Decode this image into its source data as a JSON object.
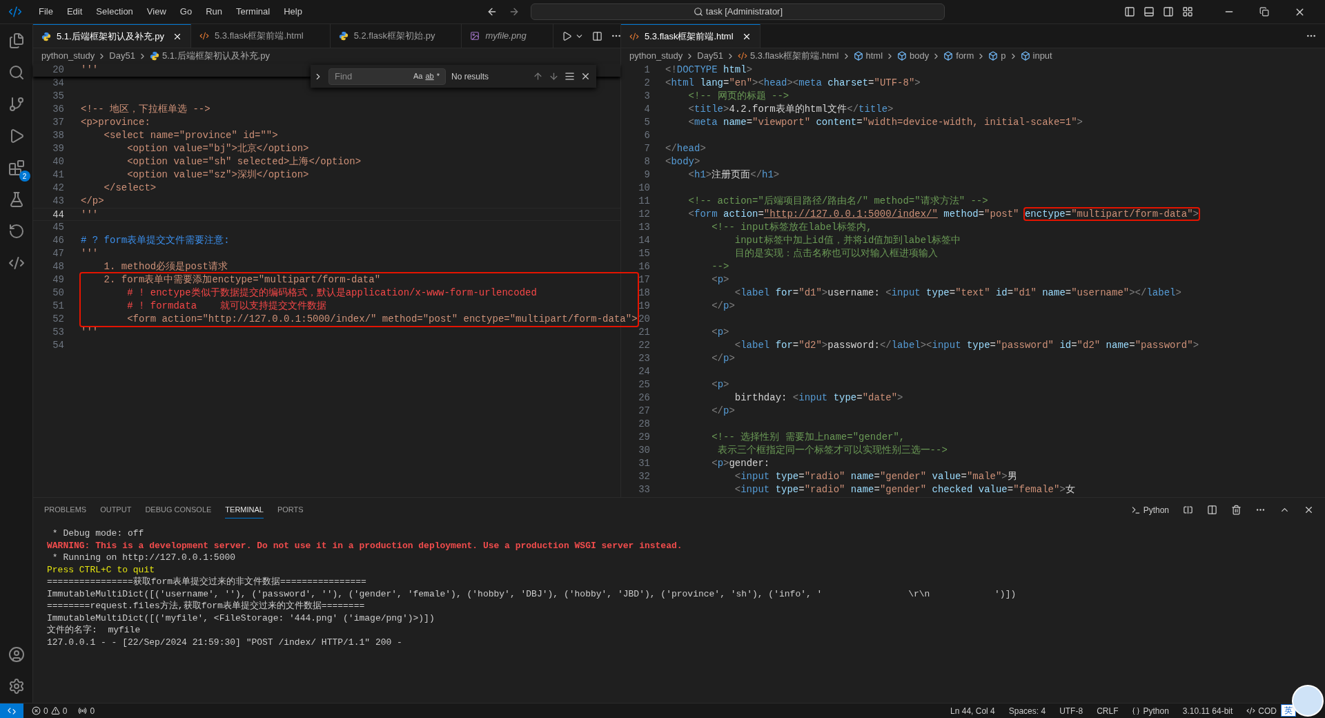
{
  "title_bar": {
    "menus": [
      "File",
      "Edit",
      "Selection",
      "View",
      "Go",
      "Run",
      "Terminal",
      "Help"
    ],
    "command_center": "task [Administrator]"
  },
  "activity_bar": {
    "extensions_badge": "2"
  },
  "left_editor": {
    "tabs": [
      {
        "label": "5.1.后端框架初认及补充.py",
        "kind": "python",
        "selected": true,
        "preview": false
      },
      {
        "label": "5.3.flask框架前端.html",
        "kind": "html",
        "selected": false,
        "preview": false
      },
      {
        "label": "5.2.flask框架初始.py",
        "kind": "python",
        "selected": false,
        "preview": false
      },
      {
        "label": "myfile.png",
        "kind": "image",
        "selected": false,
        "preview": true
      }
    ],
    "breadcrumbs": [
      {
        "text": "python_study",
        "kind": "folder"
      },
      {
        "text": "Day51",
        "kind": "folder"
      },
      {
        "text": "5.1.后端框架初认及补充.py",
        "kind": "python"
      }
    ],
    "sticky_line": {
      "n": "20",
      "text": "'''"
    },
    "find": {
      "placeholder": "Find",
      "toggles": [
        "Aa",
        "ab",
        "*"
      ],
      "result": "No results"
    },
    "lines": [
      {
        "n": "34",
        "current": false
      },
      {
        "n": "35",
        "current": false
      },
      {
        "n": "36",
        "text": "<!-- 地区，下拉框单选 -->",
        "kind": "str",
        "current": false
      },
      {
        "n": "37",
        "text": "<p>province:",
        "kind": "str",
        "current": false
      },
      {
        "n": "38",
        "text": "    <select name=\"province\" id=\"\">",
        "kind": "str",
        "current": false
      },
      {
        "n": "39",
        "text": "        <option value=\"bj\">北京</option>",
        "kind": "str",
        "current": false
      },
      {
        "n": "40",
        "text": "        <option value=\"sh\" selected>上海</option>",
        "kind": "str",
        "current": false
      },
      {
        "n": "41",
        "text": "        <option value=\"sz\">深圳</option>",
        "kind": "str",
        "current": false
      },
      {
        "n": "42",
        "text": "    </select>",
        "kind": "str",
        "current": false
      },
      {
        "n": "43",
        "text": "</p>",
        "kind": "str",
        "current": false
      },
      {
        "n": "44",
        "text": "'''",
        "kind": "str",
        "current": true
      },
      {
        "n": "45",
        "current": false
      },
      {
        "n": "46",
        "text": "# ? form表单提交文件需要注意:",
        "kind": "note",
        "current": false
      },
      {
        "n": "47",
        "text": "'''",
        "kind": "str",
        "current": false
      },
      {
        "n": "48",
        "text": "    1. method必须是post请求",
        "kind": "str",
        "current": false
      },
      {
        "kind": "box",
        "lines": [
          {
            "n": "49",
            "text": "    2. form表单中需要添加enctype=\"multipart/form-data\"",
            "kind": "str",
            "current": false
          },
          {
            "n": "50",
            "text": "        # ! enctype类似于数据提交的编码格式，默认是application/x-www-form-urlencoded",
            "kind": "alert",
            "current": false
          },
          {
            "n": "51",
            "text": "        # ! formdata    就可以支持提交文件数据",
            "kind": "alert",
            "current": false
          },
          {
            "n": "52",
            "text": "        <form action=\"http://127.0.0.1:5000/index/\" method=\"post\" enctype=\"multipart/form-data\">",
            "kind": "str",
            "current": false
          }
        ]
      },
      {
        "n": "53",
        "text": "'''",
        "kind": "str",
        "current": false
      },
      {
        "n": "54",
        "current": false
      }
    ]
  },
  "right_editor": {
    "tabs": [
      {
        "label": "5.3.flask框架前端.html",
        "kind": "html",
        "selected": true,
        "preview": false
      }
    ],
    "breadcrumbs": [
      {
        "text": "python_study",
        "kind": "folder"
      },
      {
        "text": "Day51",
        "kind": "folder"
      },
      {
        "text": "5.3.flask框架前端.html",
        "kind": "html"
      },
      {
        "text": "html",
        "kind": "element"
      },
      {
        "text": "body",
        "kind": "element"
      },
      {
        "text": "form",
        "kind": "element"
      },
      {
        "text": "p",
        "kind": "element"
      },
      {
        "text": "input",
        "kind": "element"
      }
    ],
    "lines": [
      {
        "n": "1",
        "tokens": [
          {
            "text": "<!",
            "kind": "p"
          },
          {
            "text": "DOCTYPE",
            "kind": "tg"
          },
          {
            "text": " html",
            "kind": "a"
          },
          {
            "text": ">",
            "kind": "p"
          }
        ]
      },
      {
        "n": "2",
        "tokens": [
          {
            "text": "<",
            "kind": "p"
          },
          {
            "text": "html",
            "kind": "tg"
          },
          {
            "text": " lang",
            "kind": "a"
          },
          {
            "text": "=",
            "kind": "x"
          },
          {
            "text": "\"en\"",
            "kind": "s"
          },
          {
            "text": "><",
            "kind": "p"
          },
          {
            "text": "head",
            "kind": "tg"
          },
          {
            "text": "><",
            "kind": "p"
          },
          {
            "text": "meta",
            "kind": "tg"
          },
          {
            "text": " charset",
            "kind": "a"
          },
          {
            "text": "=",
            "kind": "x"
          },
          {
            "text": "\"UTF-8\"",
            "kind": "s"
          },
          {
            "text": ">",
            "kind": "p"
          }
        ]
      },
      {
        "n": "3",
        "tokens": [
          {
            "text": "    <!-- 网页的标题 -->",
            "kind": "c"
          }
        ]
      },
      {
        "n": "4",
        "tokens": [
          {
            "text": "    <",
            "kind": "p"
          },
          {
            "text": "title",
            "kind": "tg"
          },
          {
            "text": ">",
            "kind": "p"
          },
          {
            "text": "4.2.form表单的html文件",
            "kind": "x"
          },
          {
            "text": "</",
            "kind": "p"
          },
          {
            "text": "title",
            "kind": "tg"
          },
          {
            "text": ">",
            "kind": "p"
          }
        ]
      },
      {
        "n": "5",
        "tokens": [
          {
            "text": "    <",
            "kind": "p"
          },
          {
            "text": "meta",
            "kind": "tg"
          },
          {
            "text": " name",
            "kind": "a"
          },
          {
            "text": "=",
            "kind": "x"
          },
          {
            "text": "\"viewport\"",
            "kind": "s"
          },
          {
            "text": " content",
            "kind": "a"
          },
          {
            "text": "=",
            "kind": "x"
          },
          {
            "text": "\"width=device-width, initial-scake=1\"",
            "kind": "s"
          },
          {
            "text": ">",
            "kind": "p"
          }
        ]
      },
      {
        "n": "6"
      },
      {
        "n": "7",
        "tokens": [
          {
            "text": "</",
            "kind": "p"
          },
          {
            "text": "head",
            "kind": "tg"
          },
          {
            "text": ">",
            "kind": "p"
          }
        ]
      },
      {
        "n": "8",
        "tokens": [
          {
            "text": "<",
            "kind": "p"
          },
          {
            "text": "body",
            "kind": "tg"
          },
          {
            "text": ">",
            "kind": "p"
          }
        ]
      },
      {
        "n": "9",
        "tokens": [
          {
            "text": "    <",
            "kind": "p"
          },
          {
            "text": "h1",
            "kind": "tg"
          },
          {
            "text": ">",
            "kind": "p"
          },
          {
            "text": "注册页面",
            "kind": "x"
          },
          {
            "text": "</",
            "kind": "p"
          },
          {
            "text": "h1",
            "kind": "tg"
          },
          {
            "text": ">",
            "kind": "p"
          }
        ]
      },
      {
        "n": "10"
      },
      {
        "n": "11",
        "tokens": [
          {
            "text": "    <!-- action=\"后端项目路径/路由名/\" method=\"请求方法\" -->",
            "kind": "c"
          }
        ]
      },
      {
        "n": "12",
        "tokens": [
          {
            "text": "    <",
            "kind": "p"
          },
          {
            "text": "form",
            "kind": "tg"
          },
          {
            "text": " action",
            "kind": "a"
          },
          {
            "text": "=",
            "kind": "x"
          },
          {
            "text": "\"http://127.0.0.1:5000/index/\"",
            "kind": "u"
          },
          {
            "text": " method",
            "kind": "a"
          },
          {
            "text": "=",
            "kind": "x"
          },
          {
            "text": "\"post\" ",
            "kind": "s"
          },
          {
            "kind": "boxed",
            "tokens": [
              {
                "text": "enctype",
                "kind": "a"
              },
              {
                "text": "=",
                "kind": "x"
              },
              {
                "text": "\"multipart/form-data\"",
                "kind": "s"
              },
              {
                "text": ">",
                "kind": "p"
              }
            ]
          }
        ]
      },
      {
        "n": "13",
        "tokens": [
          {
            "text": "        <!-- input标签放在label标签内,",
            "kind": "c"
          }
        ]
      },
      {
        "n": "14",
        "tokens": [
          {
            "text": "            input标签中加上id值，并将id值加到label标签中",
            "kind": "c"
          }
        ]
      },
      {
        "n": "15",
        "tokens": [
          {
            "text": "            目的是实现：点击名称也可以对输入框进项输入",
            "kind": "c"
          }
        ]
      },
      {
        "n": "16",
        "tokens": [
          {
            "text": "        -->",
            "kind": "c"
          }
        ]
      },
      {
        "n": "17",
        "tokens": [
          {
            "text": "        <",
            "kind": "p"
          },
          {
            "text": "p",
            "kind": "tg"
          },
          {
            "text": ">",
            "kind": "p"
          }
        ]
      },
      {
        "n": "18",
        "tokens": [
          {
            "text": "            <",
            "kind": "p"
          },
          {
            "text": "label",
            "kind": "tg"
          },
          {
            "text": " for",
            "kind": "a"
          },
          {
            "text": "=",
            "kind": "x"
          },
          {
            "text": "\"d1\"",
            "kind": "s"
          },
          {
            "text": ">",
            "kind": "p"
          },
          {
            "text": "username: ",
            "kind": "x"
          },
          {
            "text": "<",
            "kind": "p"
          },
          {
            "text": "input",
            "kind": "tg"
          },
          {
            "text": " type",
            "kind": "a"
          },
          {
            "text": "=",
            "kind": "x"
          },
          {
            "text": "\"text\"",
            "kind": "s"
          },
          {
            "text": " id",
            "kind": "a"
          },
          {
            "text": "=",
            "kind": "x"
          },
          {
            "text": "\"d1\"",
            "kind": "s"
          },
          {
            "text": " name",
            "kind": "a"
          },
          {
            "text": "=",
            "kind": "x"
          },
          {
            "text": "\"username\"",
            "kind": "s"
          },
          {
            "text": "></",
            "kind": "p"
          },
          {
            "text": "label",
            "kind": "tg"
          },
          {
            "text": ">",
            "kind": "p"
          }
        ]
      },
      {
        "n": "19",
        "tokens": [
          {
            "text": "        </",
            "kind": "p"
          },
          {
            "text": "p",
            "kind": "tg"
          },
          {
            "text": ">",
            "kind": "p"
          }
        ]
      },
      {
        "n": "20"
      },
      {
        "n": "21",
        "tokens": [
          {
            "text": "        <",
            "kind": "p"
          },
          {
            "text": "p",
            "kind": "tg"
          },
          {
            "text": ">",
            "kind": "p"
          }
        ]
      },
      {
        "n": "22",
        "tokens": [
          {
            "text": "            <",
            "kind": "p"
          },
          {
            "text": "label",
            "kind": "tg"
          },
          {
            "text": " for",
            "kind": "a"
          },
          {
            "text": "=",
            "kind": "x"
          },
          {
            "text": "\"d2\"",
            "kind": "s"
          },
          {
            "text": ">",
            "kind": "p"
          },
          {
            "text": "password:",
            "kind": "x"
          },
          {
            "text": "</",
            "kind": "p"
          },
          {
            "text": "label",
            "kind": "tg"
          },
          {
            "text": "><",
            "kind": "p"
          },
          {
            "text": "input",
            "kind": "tg"
          },
          {
            "text": " type",
            "kind": "a"
          },
          {
            "text": "=",
            "kind": "x"
          },
          {
            "text": "\"password\"",
            "kind": "s"
          },
          {
            "text": " id",
            "kind": "a"
          },
          {
            "text": "=",
            "kind": "x"
          },
          {
            "text": "\"d2\"",
            "kind": "s"
          },
          {
            "text": " name",
            "kind": "a"
          },
          {
            "text": "=",
            "kind": "x"
          },
          {
            "text": "\"password\"",
            "kind": "s"
          },
          {
            "text": ">",
            "kind": "p"
          }
        ]
      },
      {
        "n": "23",
        "tokens": [
          {
            "text": "        </",
            "kind": "p"
          },
          {
            "text": "p",
            "kind": "tg"
          },
          {
            "text": ">",
            "kind": "p"
          }
        ]
      },
      {
        "n": "24"
      },
      {
        "n": "25",
        "tokens": [
          {
            "text": "        <",
            "kind": "p"
          },
          {
            "text": "p",
            "kind": "tg"
          },
          {
            "text": ">",
            "kind": "p"
          }
        ]
      },
      {
        "n": "26",
        "tokens": [
          {
            "text": "            birthday: ",
            "kind": "x"
          },
          {
            "text": "<",
            "kind": "p"
          },
          {
            "text": "input",
            "kind": "tg"
          },
          {
            "text": " type",
            "kind": "a"
          },
          {
            "text": "=",
            "kind": "x"
          },
          {
            "text": "\"date\"",
            "kind": "s"
          },
          {
            "text": ">",
            "kind": "p"
          }
        ]
      },
      {
        "n": "27",
        "tokens": [
          {
            "text": "        </",
            "kind": "p"
          },
          {
            "text": "p",
            "kind": "tg"
          },
          {
            "text": ">",
            "kind": "p"
          }
        ]
      },
      {
        "n": "28"
      },
      {
        "n": "29",
        "tokens": [
          {
            "text": "        <!-- 选择性别 需要加上name=\"gender\",",
            "kind": "c"
          }
        ]
      },
      {
        "n": "30",
        "tokens": [
          {
            "text": "         表示三个框指定同一个标签才可以实现性别三选一-->",
            "kind": "c"
          }
        ]
      },
      {
        "n": "31",
        "tokens": [
          {
            "text": "        <",
            "kind": "p"
          },
          {
            "text": "p",
            "kind": "tg"
          },
          {
            "text": ">",
            "kind": "p"
          },
          {
            "text": "gender:",
            "kind": "x"
          }
        ]
      },
      {
        "n": "32",
        "tokens": [
          {
            "text": "            <",
            "kind": "p"
          },
          {
            "text": "input",
            "kind": "tg"
          },
          {
            "text": " type",
            "kind": "a"
          },
          {
            "text": "=",
            "kind": "x"
          },
          {
            "text": "\"radio\"",
            "kind": "s"
          },
          {
            "text": " name",
            "kind": "a"
          },
          {
            "text": "=",
            "kind": "x"
          },
          {
            "text": "\"gender\"",
            "kind": "s"
          },
          {
            "text": " value",
            "kind": "a"
          },
          {
            "text": "=",
            "kind": "x"
          },
          {
            "text": "\"male\"",
            "kind": "s"
          },
          {
            "text": ">",
            "kind": "p"
          },
          {
            "text": "男",
            "kind": "x"
          }
        ]
      },
      {
        "n": "33",
        "tokens": [
          {
            "text": "            <",
            "kind": "p"
          },
          {
            "text": "input",
            "kind": "tg"
          },
          {
            "text": " type",
            "kind": "a"
          },
          {
            "text": "=",
            "kind": "x"
          },
          {
            "text": "\"radio\"",
            "kind": "s"
          },
          {
            "text": " name",
            "kind": "a"
          },
          {
            "text": "=",
            "kind": "x"
          },
          {
            "text": "\"gender\"",
            "kind": "s"
          },
          {
            "text": " checked",
            "kind": "a"
          },
          {
            "text": " value",
            "kind": "a"
          },
          {
            "text": "=",
            "kind": "x"
          },
          {
            "text": "\"female\"",
            "kind": "s"
          },
          {
            "text": ">",
            "kind": "p"
          },
          {
            "text": "女",
            "kind": "x"
          }
        ]
      }
    ]
  },
  "panel": {
    "tabs": [
      {
        "label": "PROBLEMS",
        "selected": false
      },
      {
        "label": "OUTPUT",
        "selected": false
      },
      {
        "label": "DEBUG CONSOLE",
        "selected": false
      },
      {
        "label": "TERMINAL",
        "selected": true
      },
      {
        "label": "PORTS",
        "selected": false
      }
    ],
    "terminal_name": "Python",
    "terminal_lines": [
      {
        "text": " * Debug mode: off",
        "kind": "normal"
      },
      {
        "text": "WARNING: This is a development server. Do not use it in a production deployment. Use a production WSGI server instead.",
        "kind": "warning"
      },
      {
        "text": " * Running on http://127.0.0.1:5000",
        "kind": "normal"
      },
      {
        "text": "Press CTRL+C to quit",
        "kind": "yellow"
      },
      {
        "text": "================获取form表单提交过来的非文件数据================",
        "kind": "normal"
      },
      {
        "text": "ImmutableMultiDict([('username', ''), ('password', ''), ('gender', 'female'), ('hobby', 'DBJ'), ('hobby', 'JBD'), ('province', 'sh'), ('info', '                \\r\\n            ')])",
        "kind": "normal"
      },
      {
        "text": "========request.files方法,获取form表单提交过来的文件数据========",
        "kind": "normal"
      },
      {
        "text": "ImmutableMultiDict([('myfile', <FileStorage: '444.png' ('image/png')>)])",
        "kind": "normal"
      },
      {
        "text": "文件的名字:  myfile",
        "kind": "normal"
      },
      {
        "text": "127.0.0.1 - - [22/Sep/2024 21:59:30] \"POST /index/ HTTP/1.1\" 200 -",
        "kind": "normal"
      }
    ]
  },
  "status_bar": {
    "errors": "0",
    "warnings": "0",
    "ports": "0",
    "items": [
      {
        "text": "Ln 44, Col 4",
        "kind": "plain"
      },
      {
        "text": "Spaces: 4",
        "kind": "plain"
      },
      {
        "text": "UTF-8",
        "kind": "plain"
      },
      {
        "text": "CRLF",
        "kind": "plain"
      },
      {
        "text": "Python",
        "kind": "language"
      },
      {
        "text": "3.10.11 64-bit",
        "kind": "plain"
      },
      {
        "text": "COD",
        "kind": "code"
      }
    ],
    "ime": "英"
  }
}
